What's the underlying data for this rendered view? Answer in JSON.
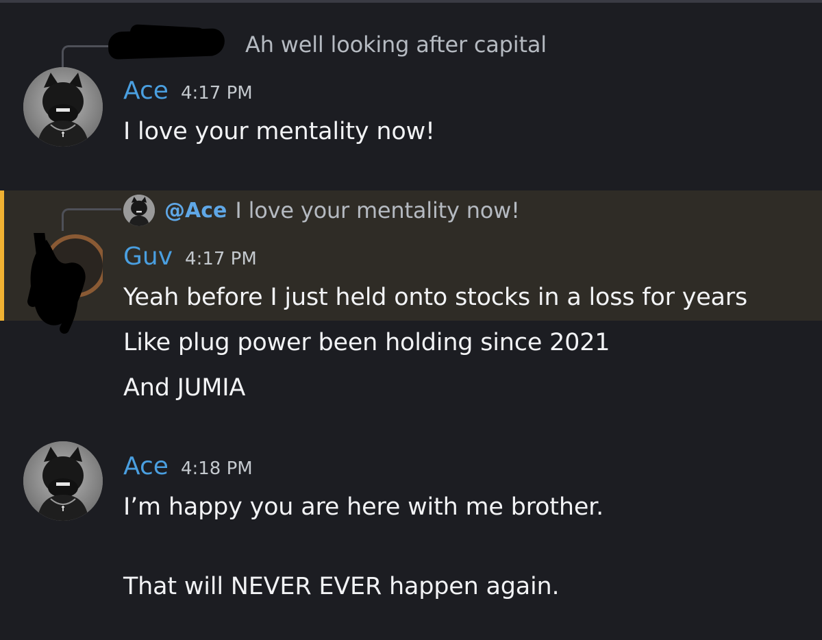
{
  "messages": [
    {
      "reply": {
        "author": "",
        "text": "Ah well looking after capital"
      },
      "author": "Ace",
      "time": "4:17 PM",
      "lines": [
        "I love your mentality now!"
      ],
      "avatar": "dog-avatar"
    },
    {
      "highlighted": true,
      "reply": {
        "mention": "@Ace",
        "text": "I love your mentality now!"
      },
      "author": "Guv",
      "time": "4:17 PM",
      "lines": [
        "Yeah before I just held onto stocks in a loss for years",
        "Like plug power been holding since 2021",
        "And JUMIA"
      ],
      "avatar": "redacted-avatar"
    },
    {
      "author": "Ace",
      "time": "4:18 PM",
      "lines": [
        "I’m happy you are here with me brother.",
        "",
        "That will NEVER EVER happen again."
      ],
      "avatar": "dog-avatar"
    }
  ],
  "colors": {
    "background": "#1c1d22",
    "username": "#4a9fe0",
    "mention": "#5fa7e6",
    "highlight": "#2f2c26",
    "highlight_bar": "#f0b232"
  }
}
